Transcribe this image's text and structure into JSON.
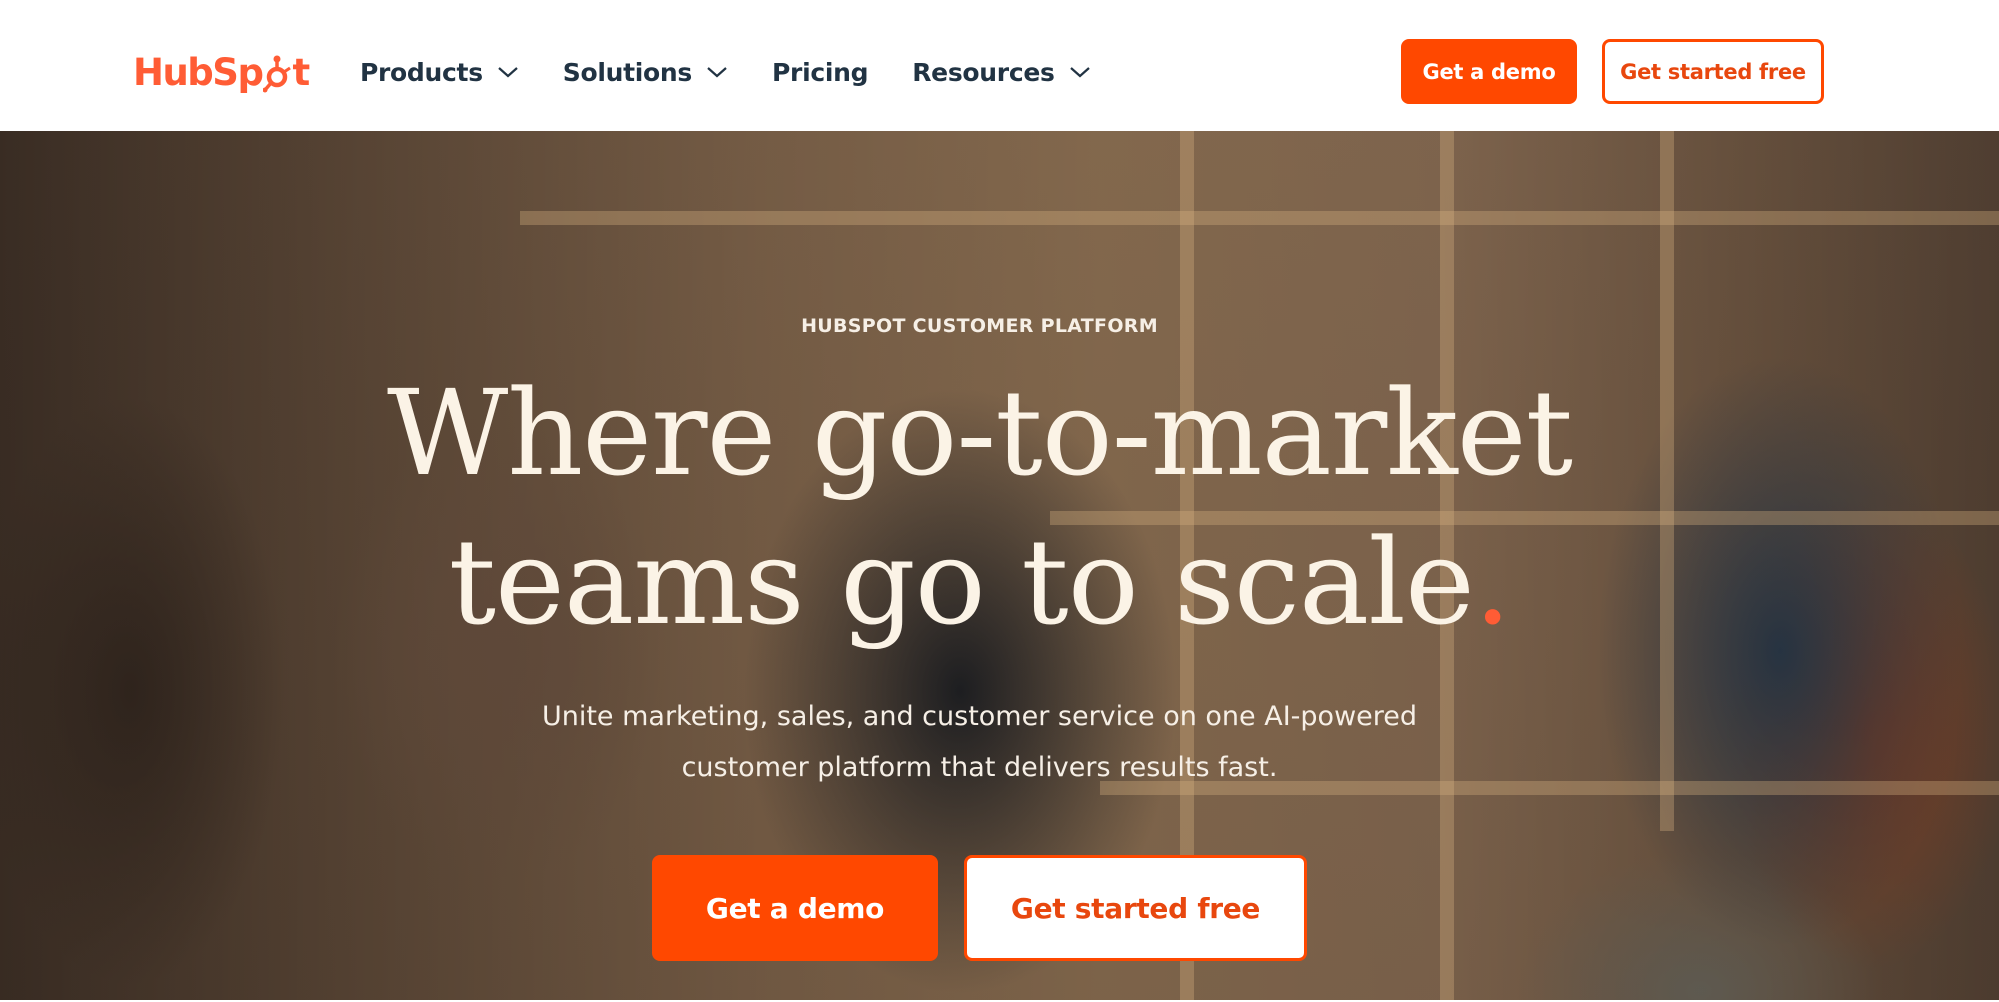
{
  "brand": {
    "name": "HubSpot",
    "logo_left": "HubSp",
    "logo_right": "t",
    "color": "#ff5c35"
  },
  "nav": {
    "items": [
      {
        "label": "Products",
        "has_dropdown": true
      },
      {
        "label": "Solutions",
        "has_dropdown": true
      },
      {
        "label": "Pricing",
        "has_dropdown": false
      },
      {
        "label": "Resources",
        "has_dropdown": true
      }
    ],
    "demo_label": "Get a demo",
    "free_label": "Get started free"
  },
  "hero": {
    "eyebrow": "HUBSPOT CUSTOMER PLATFORM",
    "headline_line1": "Where go-to-market",
    "headline_line2": "teams go to scale",
    "headline_dot": ".",
    "subhead_line1": "Unite marketing, sales, and customer service on one AI-powered",
    "subhead_line2": "customer platform that delivers results fast.",
    "demo_label": "Get a demo",
    "free_label": "Get started free"
  },
  "colors": {
    "accent": "#ff4800",
    "text_dark": "#213343",
    "hero_text": "#fbf3e6"
  },
  "icons": {
    "nav_dropdown": "chevron-down-icon",
    "logo_mark": "sprocket-icon"
  }
}
